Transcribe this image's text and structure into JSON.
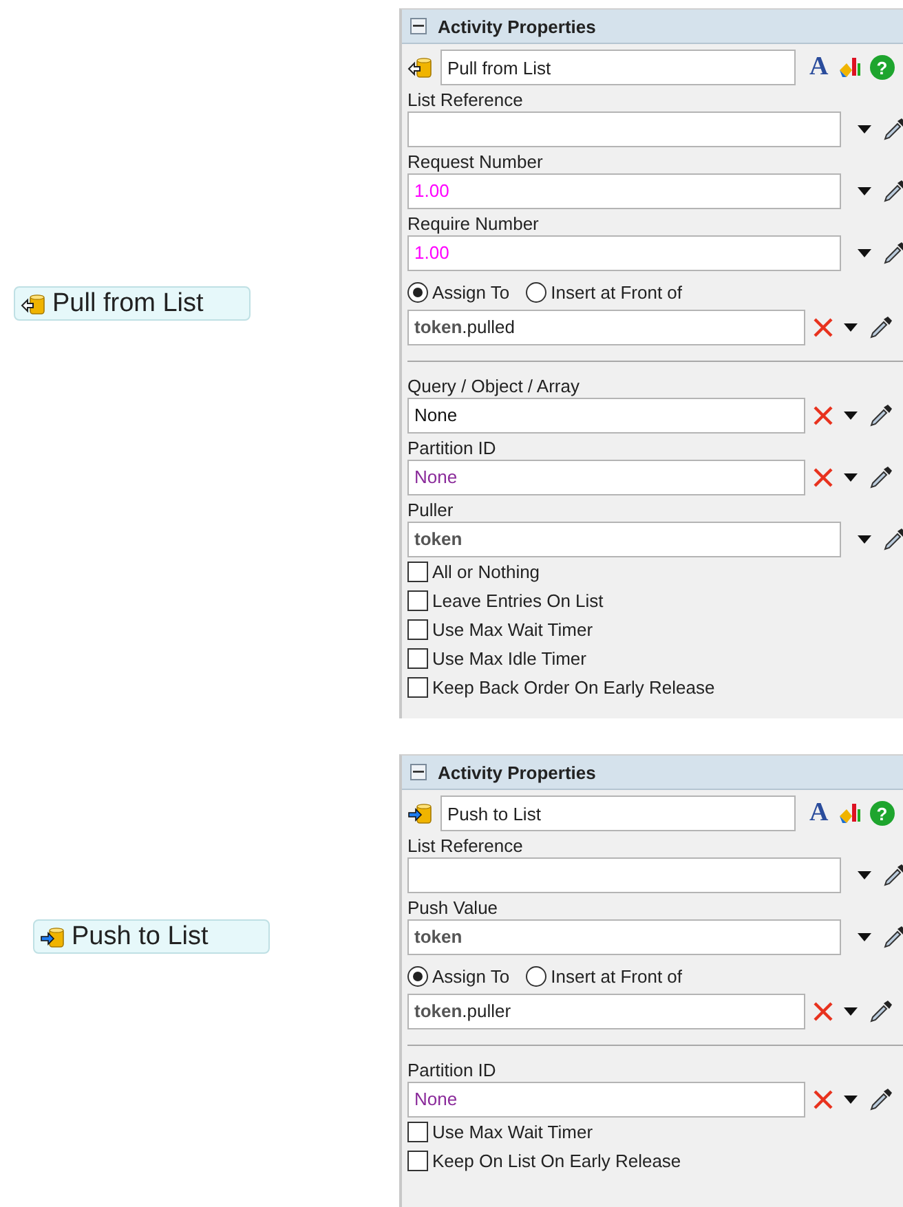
{
  "activities": [
    {
      "node_label": "Pull from List",
      "kind": "pull",
      "panel": {
        "title": "Activity Properties",
        "name": "Pull from List",
        "font_glyph": "A",
        "help_glyph": "?",
        "rows": [
          {
            "kind": "field",
            "label": "List Reference",
            "clearable": false
          },
          {
            "kind": "field",
            "label": "Request Number",
            "value": {
              "kind": "number",
              "text": "1.00"
            },
            "clearable": false
          },
          {
            "kind": "field",
            "label": "Require Number",
            "value": {
              "kind": "number",
              "text": "1.00"
            },
            "clearable": false
          },
          {
            "kind": "radio",
            "options": [
              {
                "label": "Assign To",
                "selected": true
              },
              {
                "label": "Insert at Front of",
                "selected": false
              }
            ]
          },
          {
            "kind": "field",
            "value": {
              "kind": "expression",
              "text": "**token**.pulled"
            },
            "clearable": true
          },
          {
            "kind": "separator"
          },
          {
            "kind": "field",
            "label": "Query / Object / Array",
            "value": {
              "kind": "plain",
              "text": "None"
            },
            "clearable": true
          },
          {
            "kind": "field",
            "label": "Partition ID",
            "value": {
              "kind": "constant",
              "text": "None"
            },
            "clearable": true
          },
          {
            "kind": "field",
            "label": "Puller",
            "value": {
              "kind": "keyword",
              "text": "token"
            },
            "clearable": false
          },
          {
            "kind": "checkbox",
            "label": "All or Nothing",
            "checked": false
          },
          {
            "kind": "checkbox",
            "label": "Leave Entries On List",
            "checked": false
          },
          {
            "kind": "checkbox",
            "label": "Use Max Wait Timer",
            "checked": false
          },
          {
            "kind": "checkbox",
            "label": "Use Max Idle Timer",
            "checked": false
          },
          {
            "kind": "checkbox",
            "label": "Keep Back Order On Early Release",
            "checked": false
          }
        ]
      }
    },
    {
      "node_label": "Push to List",
      "kind": "push",
      "panel": {
        "title": "Activity Properties",
        "name": "Push to List",
        "font_glyph": "A",
        "help_glyph": "?",
        "rows": [
          {
            "kind": "field",
            "label": "List Reference",
            "clearable": false
          },
          {
            "kind": "field",
            "label": "Push Value",
            "value": {
              "kind": "keyword",
              "text": "token"
            },
            "clearable": false
          },
          {
            "kind": "radio",
            "options": [
              {
                "label": "Assign To",
                "selected": true
              },
              {
                "label": "Insert at Front of",
                "selected": false
              }
            ]
          },
          {
            "kind": "field",
            "value": {
              "kind": "expression",
              "text": "**token**.puller"
            },
            "clearable": true
          },
          {
            "kind": "separator"
          },
          {
            "kind": "field",
            "label": "Partition ID",
            "value": {
              "kind": "constant",
              "text": "None"
            },
            "clearable": true
          },
          {
            "kind": "checkbox",
            "label": "Use Max Wait Timer",
            "checked": false
          },
          {
            "kind": "checkbox",
            "label": "Keep On List On Early Release",
            "checked": false
          }
        ]
      }
    }
  ]
}
